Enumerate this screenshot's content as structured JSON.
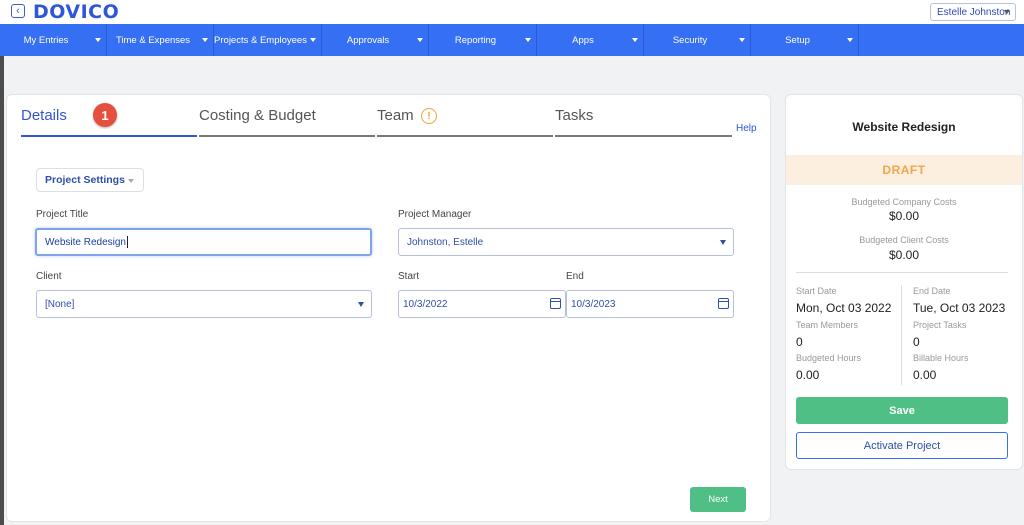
{
  "app": {
    "logo": "DOVICO",
    "back_icon": "chevron-left-icon"
  },
  "user": {
    "name": "Estelle Johnston"
  },
  "nav": {
    "items": [
      {
        "label": "My Entries"
      },
      {
        "label": "Time & Expenses"
      },
      {
        "label": "Projects & Employees"
      },
      {
        "label": "Approvals"
      },
      {
        "label": "Reporting"
      },
      {
        "label": "Apps"
      },
      {
        "label": "Security"
      },
      {
        "label": "Setup"
      }
    ]
  },
  "tabs": {
    "details": "Details",
    "details_badge": "1",
    "costing": "Costing & Budget",
    "team": "Team",
    "team_warning": "!",
    "tasks": "Tasks",
    "help": "Help"
  },
  "form": {
    "settings_button": "Project Settings",
    "project_title_label": "Project Title",
    "project_title_value": "Website Redesign",
    "project_manager_label": "Project Manager",
    "project_manager_value": "Johnston, Estelle",
    "client_label": "Client",
    "client_value": "[None]",
    "start_label": "Start",
    "start_value": "10/3/2022",
    "end_label": "End",
    "end_value": "10/3/2023",
    "next_button": "Next"
  },
  "summary": {
    "title": "Website Redesign",
    "status": "DRAFT",
    "budgeted_company_costs_label": "Budgeted Company Costs",
    "budgeted_company_costs_value": "$0.00",
    "budgeted_client_costs_label": "Budgeted Client Costs",
    "budgeted_client_costs_value": "$0.00",
    "start_date_label": "Start Date",
    "start_date_value": "Mon, Oct 03 2022",
    "end_date_label": "End Date",
    "end_date_value": "Tue, Oct 03 2023",
    "team_members_label": "Team Members",
    "team_members_value": "0",
    "project_tasks_label": "Project Tasks",
    "project_tasks_value": "0",
    "budgeted_hours_label": "Budgeted Hours",
    "budgeted_hours_value": "0.00",
    "billable_hours_label": "Billable Hours",
    "billable_hours_value": "0.00",
    "save_button": "Save",
    "activate_button": "Activate Project"
  },
  "colors": {
    "brand": "#2f56d6",
    "nav_bg": "#3570f4",
    "success": "#4fbf86",
    "draft_bg": "#fcefe0",
    "draft_text": "#f0a64a",
    "badge": "#e4503d"
  }
}
